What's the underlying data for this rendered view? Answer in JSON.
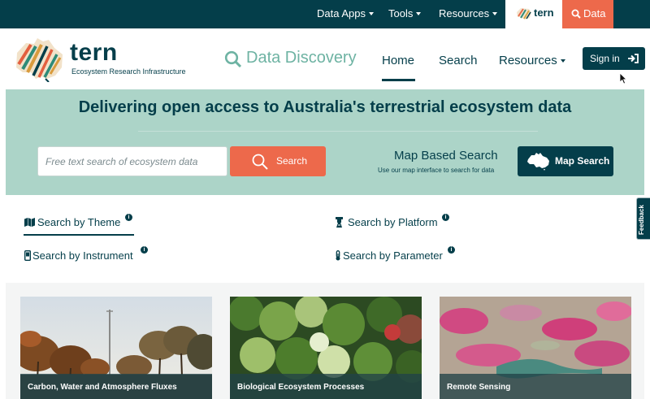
{
  "topbar": {
    "items": [
      {
        "label": "Data Apps"
      },
      {
        "label": "Tools"
      },
      {
        "label": "Resources"
      }
    ],
    "tern_tab": {
      "label": "tern"
    },
    "data_tab": {
      "label": "Data"
    }
  },
  "header": {
    "logo_word": "tern",
    "logo_sub": "Ecosystem Research Infrastructure",
    "app_title": "Data Discovery",
    "nav": [
      {
        "label": "Home",
        "active": true
      },
      {
        "label": "Search"
      },
      {
        "label": "Resources"
      }
    ],
    "signin_label": "Sign in"
  },
  "hero": {
    "title": "Delivering open access to Australia's terrestrial ecosystem data",
    "search_placeholder": "Free text search of ecosystem data",
    "search_button": "Search",
    "map_title": "Map Based Search",
    "map_subtitle": "Use our map interface to search for data",
    "map_button": "Map Search"
  },
  "search_by": [
    {
      "label": "Search by Theme",
      "icon": "map-icon",
      "active": true
    },
    {
      "label": "Search by Platform",
      "icon": "tower-icon"
    },
    {
      "label": "Search by Instrument",
      "icon": "device-icon"
    },
    {
      "label": "Search by Parameter",
      "icon": "thermometer-icon"
    }
  ],
  "info_glyph": "i",
  "feedback": "Feedback",
  "cards": [
    {
      "title": "Carbon, Water and Atmosphere Fluxes"
    },
    {
      "title": "Biological Ecosystem Processes"
    },
    {
      "title": "Remote Sensing"
    }
  ],
  "colors": {
    "primary": "#043e4a",
    "accent": "#ed694b",
    "hero_bg": "#acd4c8",
    "title_teal": "#6eb3a3"
  }
}
